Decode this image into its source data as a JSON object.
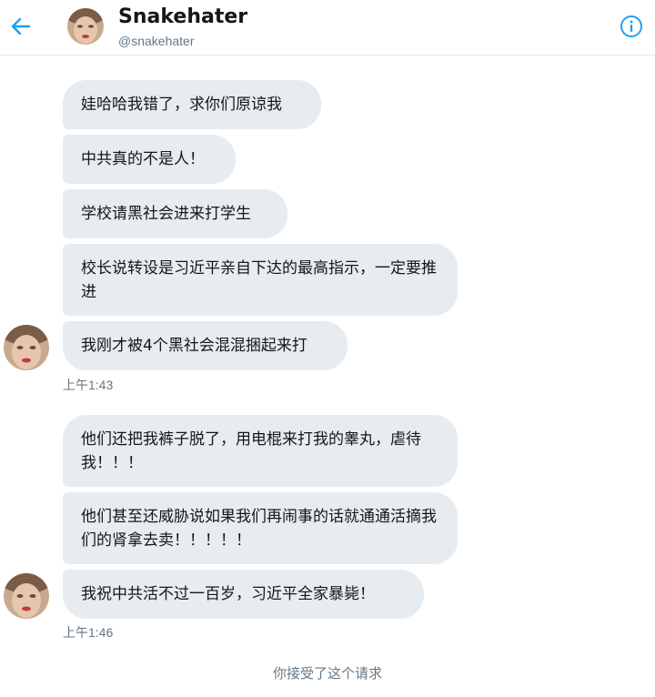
{
  "header": {
    "name": "Snakehater",
    "handle": "@snakehater"
  },
  "messages": [
    {
      "text": "娃哈哈我错了，求你们原谅我"
    },
    {
      "text": "中共真的不是人！"
    },
    {
      "text": "学校请黑社会进来打学生"
    },
    {
      "text": "校长说转设是习近平亲自下达的最高指示，一定要推进"
    },
    {
      "text": "我刚才被4个黑社会混混捆起来打"
    },
    {
      "text": "他们还把我裤子脱了，用电棍来打我的睾丸，虐待我！！！"
    },
    {
      "text": "他们甚至还威胁说如果我们再闹事的话就通通活摘我们的肾拿去卖！！！！！"
    },
    {
      "text": "我祝中共活不过一百岁，习近平全家暴毙！"
    }
  ],
  "timestamps": [
    "上午1:43",
    "上午1:46"
  ],
  "notice": "你接受了这个请求",
  "colors": {
    "accent": "#1da1f2",
    "bubble": "#e6ecf0",
    "secondary_text": "#657786"
  },
  "icons": [
    "back-arrow-icon",
    "info-icon",
    "avatar"
  ]
}
